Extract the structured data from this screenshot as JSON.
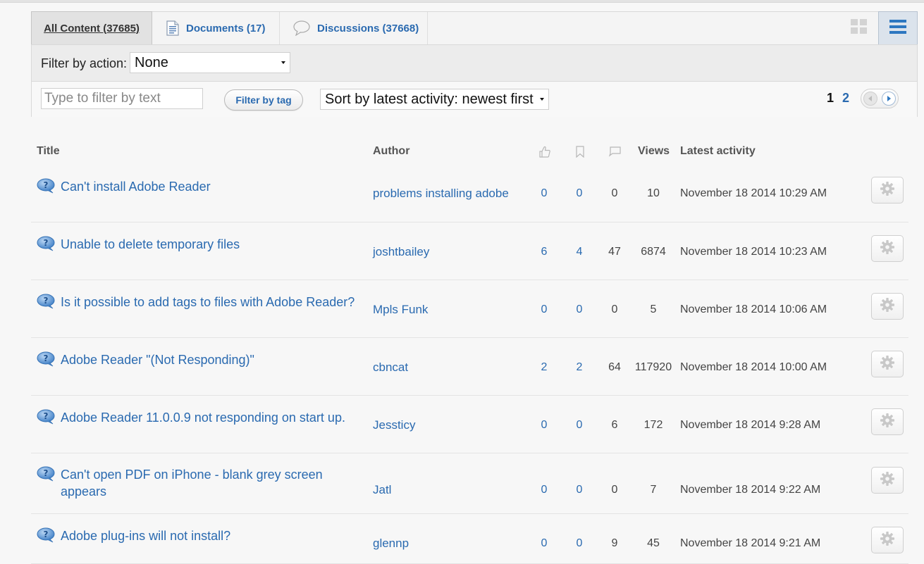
{
  "tabs": [
    {
      "label": "All Content (37685)",
      "icon": "none"
    },
    {
      "label": "Documents (17)",
      "icon": "document-icon"
    },
    {
      "label": "Discussions (37668)",
      "icon": "speech-bubble-icon"
    }
  ],
  "view_toggle": {
    "grid_icon": "grid-view-icon",
    "list_icon": "list-view-icon"
  },
  "filters": {
    "action_label": "Filter by action:",
    "action_value": "None",
    "text_placeholder": "Type to filter by text",
    "tag_button": "Filter by tag",
    "sort_value": "Sort by latest activity: newest first"
  },
  "pagination": {
    "pages": [
      "1",
      "2"
    ],
    "current": "1",
    "prev_icon": "prev-arrow-icon",
    "next_icon": "next-arrow-icon"
  },
  "columns": {
    "title": "Title",
    "author": "Author",
    "likes_icon": "thumbs-up-icon",
    "bookmarks_icon": "bookmark-icon",
    "replies_icon": "comment-icon",
    "views": "Views",
    "latest": "Latest activity"
  },
  "rows": [
    {
      "title": "Can't install Adobe Reader",
      "author": "problems installing adobe",
      "likes": "0",
      "bookmarks": "0",
      "replies": "0",
      "views": "10",
      "latest": "November 18 2014 10:29 AM"
    },
    {
      "title": "Unable to delete temporary files",
      "author": "joshtbailey",
      "likes": "6",
      "bookmarks": "4",
      "replies": "47",
      "views": "6874",
      "latest": "November 18 2014 10:23 AM"
    },
    {
      "title": "Is it possible to add tags to files with Adobe Reader?",
      "author": "Mpls Funk",
      "likes": "0",
      "bookmarks": "0",
      "replies": "0",
      "views": "5",
      "latest": "November 18 2014 10:06 AM"
    },
    {
      "title": "Adobe Reader \"(Not Responding)\"",
      "author": "cbncat",
      "likes": "2",
      "bookmarks": "2",
      "replies": "64",
      "views": "117920",
      "latest": "November 18 2014 10:00 AM"
    },
    {
      "title": "Adobe Reader 11.0.0.9 not responding on start up.",
      "author": "Jessticy",
      "likes": "0",
      "bookmarks": "0",
      "replies": "6",
      "views": "172",
      "latest": "November 18 2014 9:28 AM"
    },
    {
      "title": "Can't open PDF on iPhone - blank grey screen appears",
      "author": "Jatl",
      "likes": "0",
      "bookmarks": "0",
      "replies": "0",
      "views": "7",
      "latest": "November 18 2014 9:22 AM"
    },
    {
      "title": "Adobe plug-ins will not install?",
      "author": "glennp",
      "likes": "0",
      "bookmarks": "0",
      "replies": "9",
      "views": "45",
      "latest": "November 18 2014 9:21 AM"
    }
  ],
  "colors": {
    "link": "#2a6ab0",
    "text": "#333333",
    "background": "#f7f7f7"
  }
}
